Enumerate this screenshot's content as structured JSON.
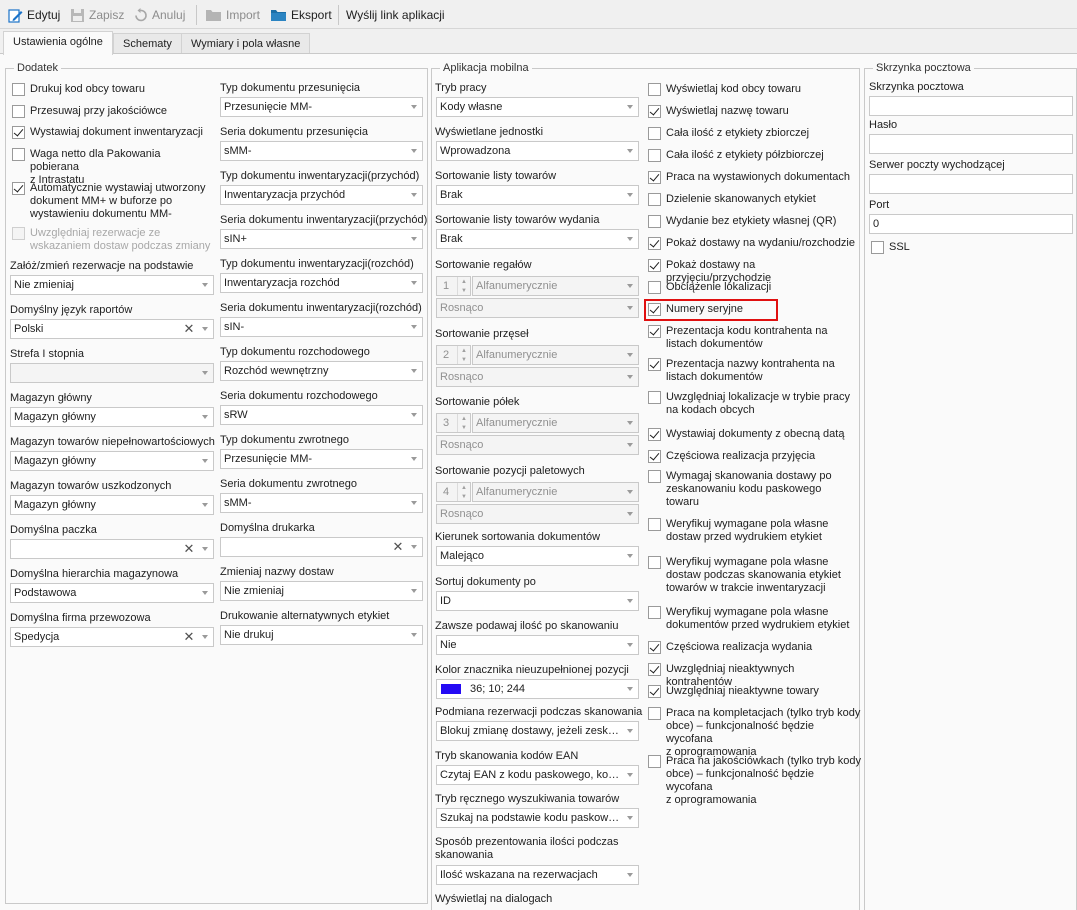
{
  "toolbar": {
    "edit": "Edytuj",
    "save": "Zapisz",
    "cancel": "Anuluj",
    "import": "Import",
    "export": "Eksport",
    "send_link": "Wyślij link aplikacji"
  },
  "tabs": [
    "Ustawienia ogólne",
    "Schematy",
    "Wymiary i pola własne"
  ],
  "dodatek": {
    "title": "Dodatek",
    "checks": [
      {
        "label": "Drukuj kod obcy towaru",
        "checked": false
      },
      {
        "label": "Przesuwaj przy jakościówce",
        "checked": false
      },
      {
        "label": "Wystawiaj dokument inwentaryzacji",
        "checked": true
      },
      {
        "label": "Waga netto dla Pakowania pobierana",
        "label2": "z Intrastatu",
        "checked": false
      },
      {
        "label": "Automatycznie wystawiaj utworzony",
        "label2": "dokument MM+ w buforze po",
        "label3": "wystawieniu dokumentu MM-",
        "checked": true
      },
      {
        "label": "Uwzględniaj rezerwacje ze",
        "label2": "wskazaniem dostaw podczas zmiany",
        "checked": false,
        "disabled": true
      }
    ],
    "left_fields": [
      {
        "label": "Załóż/zmień rezerwacje na podstawie",
        "value": "Nie zmieniaj"
      },
      {
        "label": "Domyślny język raportów",
        "value": "Polski"
      },
      {
        "label": "Strefa I stopnia",
        "value": ""
      },
      {
        "label": "Magazyn główny",
        "value": "Magazyn główny"
      },
      {
        "label": "Magazyn towarów niepełnowartościowych",
        "value": "Magazyn główny"
      },
      {
        "label": "Magazyn towarów uszkodzonych",
        "value": "Magazyn główny"
      },
      {
        "label": "Domyślna paczka",
        "value": ""
      },
      {
        "label": "Domyślna hierarchia magazynowa",
        "value": "Podstawowa"
      },
      {
        "label": "Domyślna firma przewozowa",
        "value": "Spedycja"
      }
    ],
    "right_fields": [
      {
        "label": "Typ dokumentu przesunięcia",
        "value": "Przesunięcie MM-"
      },
      {
        "label": "Seria dokumentu przesunięcia",
        "value": "sMM-"
      },
      {
        "label": "Typ dokumentu inwentaryzacji(przychód)",
        "value": "Inwentaryzacja przychód"
      },
      {
        "label": "Seria dokumentu inwentaryzacji(przychód)",
        "value": "sIN+"
      },
      {
        "label": "Typ dokumentu inwentaryzacji(rozchód)",
        "value": "Inwentaryzacja rozchód"
      },
      {
        "label": "Seria dokumentu inwentaryzacji(rozchód)",
        "value": "sIN-"
      },
      {
        "label": "Typ dokumentu rozchodowego",
        "value": "Rozchód wewnętrzny"
      },
      {
        "label": "Seria dokumentu rozchodowego",
        "value": "sRW"
      },
      {
        "label": "Typ dokumentu zwrotnego",
        "value": "Przesunięcie MM-"
      },
      {
        "label": "Seria dokumentu zwrotnego",
        "value": "sMM-"
      },
      {
        "label": "Domyślna drukarka",
        "value": ""
      },
      {
        "label": "Zmieniaj nazwy dostaw",
        "value": "Nie zmieniaj"
      },
      {
        "label": "Drukowanie alternatywnych etykiet",
        "value": "Nie drukuj"
      }
    ]
  },
  "mobile": {
    "title": "Aplikacja mobilna",
    "fields": [
      {
        "label": "Tryb pracy",
        "value": "Kody własne"
      },
      {
        "label": "Wyświetlane jednostki",
        "value": "Wprowadzona"
      },
      {
        "label": "Sortowanie listy towarów",
        "value": "Brak"
      },
      {
        "label": "Sortowanie listy towarów wydania",
        "value": "Brak"
      },
      {
        "label": "Sortowanie regałów",
        "spin": "1",
        "value": "Alfanumerycznie",
        "order": "Rosnąco"
      },
      {
        "label": "Sortowanie przęseł",
        "spin": "2",
        "value": "Alfanumerycznie",
        "order": "Rosnąco"
      },
      {
        "label": "Sortowanie półek",
        "spin": "3",
        "value": "Alfanumerycznie",
        "order": "Rosnąco"
      },
      {
        "label": "Sortowanie pozycji paletowych",
        "spin": "4",
        "value": "Alfanumerycznie",
        "order": "Rosnąco"
      },
      {
        "label": "Kierunek sortowania dokumentów",
        "value": "Malejąco"
      },
      {
        "label": "Sortuj dokumenty po",
        "value": "ID"
      },
      {
        "label": "Zawsze podawaj ilość po skanowaniu",
        "value": "Nie"
      },
      {
        "label": "Kolor znacznika nieuzupełnionej pozycji",
        "value": "36; 10; 244",
        "color": "#240af4"
      },
      {
        "label": "Podmiana rezerwacji podczas skanowania",
        "value": "Blokuj zmianę dostawy, jeżeli zeska..."
      },
      {
        "label": "Tryb skanowania kodów EAN",
        "value": "Czytaj EAN z kodu paskowego, kod..."
      },
      {
        "label": "Tryb ręcznego wyszukiwania towarów",
        "value": "Szukaj na podstawie kodu paskowe..."
      },
      {
        "label": "Sposób prezentowania ilości podczas",
        "label2": "skanowania",
        "value": "Ilość wskazana na rezerwacjach"
      },
      {
        "label": "Wyświetlaj na dialogach"
      }
    ],
    "checks": [
      {
        "label": "Wyświetlaj kod obcy towaru",
        "checked": false
      },
      {
        "label": "Wyświetlaj nazwę towaru",
        "checked": true
      },
      {
        "label": "Cała ilość z etykiety zbiorczej",
        "checked": false
      },
      {
        "label": "Cała ilość z etykiety półzbiorczej",
        "checked": false
      },
      {
        "label": "Praca na wystawionych dokumentach",
        "checked": true
      },
      {
        "label": "Dzielenie skanowanych etykiet",
        "checked": false
      },
      {
        "label": "Wydanie bez etykiety własnej (QR)",
        "checked": false
      },
      {
        "label": "Pokaż dostawy na wydaniu/rozchodzie",
        "checked": true
      },
      {
        "label": "Pokaż dostawy na przyjęciu/przychodzie",
        "checked": true
      },
      {
        "label": "Obciążenie lokalizacji",
        "checked": false
      },
      {
        "label": "Numery seryjne",
        "checked": true,
        "highlight": true
      },
      {
        "label": "Prezentacja kodu kontrahenta na",
        "label2": "listach dokumentów",
        "checked": true
      },
      {
        "label": "Prezentacja nazwy kontrahenta na",
        "label2": "listach dokumentów",
        "checked": true
      },
      {
        "label": "Uwzględniaj lokalizacje w trybie pracy",
        "label2": "na kodach obcych",
        "checked": false
      },
      {
        "label": "Wystawiaj dokumenty z obecną datą",
        "checked": true
      },
      {
        "label": "Częściowa realizacja przyjęcia",
        "checked": true
      },
      {
        "label": "Wymagaj skanowania dostawy po",
        "label2": "zeskanowaniu kodu paskowego",
        "label3": "towaru",
        "checked": false
      },
      {
        "label": "Weryfikuj wymagane pola własne",
        "label2": "dostaw przed wydrukiem etykiet",
        "checked": false
      },
      {
        "label": "Weryfikuj wymagane pola własne",
        "label2": "dostaw podczas skanowania etykiet",
        "label3": "towarów w trakcie inwentaryzacji",
        "checked": false
      },
      {
        "label": "Weryfikuj wymagane pola własne",
        "label2": "dokumentów przed wydrukiem etykiet",
        "checked": false
      },
      {
        "label": "Częściowa realizacja wydania",
        "checked": true
      },
      {
        "label": "Uwzględniaj nieaktywnych kontrahentów",
        "checked": true
      },
      {
        "label": "Uwzględniaj nieaktywne towary",
        "checked": true
      },
      {
        "label": "Praca na kompletacjach (tylko tryb kody",
        "label2": "obce) – funkcjonalność będzie wycofana",
        "label3": "z oprogramowania",
        "checked": false
      },
      {
        "label": "Praca na jakościówkach (tylko tryb kody",
        "label2": "obce) – funkcjonalność będzie wycofana",
        "label3": "z oprogramowania",
        "checked": false
      }
    ]
  },
  "mail": {
    "title": "Skrzynka pocztowa",
    "fields": [
      {
        "label": "Skrzynka pocztowa",
        "value": ""
      },
      {
        "label": "Hasło",
        "value": ""
      },
      {
        "label": "Serwer poczty wychodzącej",
        "value": ""
      },
      {
        "label": "Port",
        "value": "0"
      }
    ],
    "ssl_label": "SSL",
    "ssl_checked": false
  },
  "colors": {
    "accent": "#1a73c9",
    "highlight": "#e01010",
    "marker": "#240af4"
  }
}
